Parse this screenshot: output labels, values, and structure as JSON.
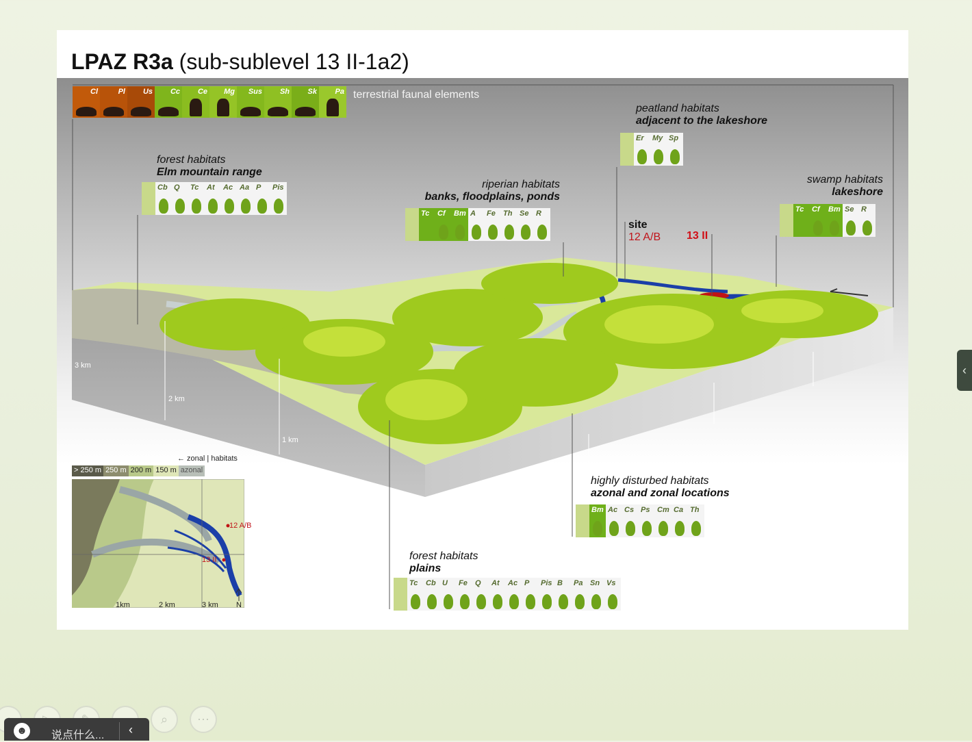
{
  "slide": {
    "title_bold": "LPAZ R3a",
    "title_rest": " (sub-sublevel 13 II-1a2)"
  },
  "fauna": {
    "caption": "terrestrial faunal elements",
    "cells": [
      {
        "code": "Cl",
        "color": "#c25a0a"
      },
      {
        "code": "Pl",
        "color": "#b85309"
      },
      {
        "code": "Us",
        "color": "#a84a08"
      },
      {
        "code": "Cc",
        "color": "#7fb51c"
      },
      {
        "code": "Ce",
        "color": "#8bbd20"
      },
      {
        "code": "Mg",
        "color": "#95c426"
      },
      {
        "code": "Sus",
        "color": "#84b81d"
      },
      {
        "code": "Sh",
        "color": "#8fc023"
      },
      {
        "code": "Sk",
        "color": "#7aae19"
      },
      {
        "code": "Pa",
        "color": "#9ac82c"
      }
    ]
  },
  "habitats": {
    "forest_elm": {
      "line1": "forest habitats",
      "line2": "Elm mountain range",
      "species": [
        "Cb",
        "Q",
        "Tc",
        "At",
        "Ac",
        "Aa",
        "P",
        "Pis"
      ]
    },
    "riperian": {
      "line1": "riperian habitats",
      "line2": "banks, floodplains, ponds",
      "species": [
        "Cf",
        "Bm",
        "A",
        "Fe",
        "Th",
        "Se",
        "R"
      ],
      "extra": "Tc"
    },
    "peatland": {
      "line1": "peatland habitats",
      "line2": "adjacent to the lakeshore",
      "species": [
        "Er",
        "My",
        "Sp"
      ]
    },
    "swamp": {
      "line1": "swamp habitats",
      "line2": "lakeshore",
      "species": [
        "Cf",
        "Bm",
        "Se",
        "R"
      ],
      "extra": "Tc"
    },
    "disturbed": {
      "line1": "highly disturbed habitats",
      "line2": "azonal and zonal locations",
      "species": [
        "Bm",
        "Ac",
        "Cs",
        "Ps",
        "Cm",
        "Ca",
        "Th"
      ]
    },
    "forest_plains": {
      "line1": "forest habitats",
      "line2": "plains",
      "species": [
        "Tc",
        "Cb",
        "U",
        "Fe",
        "Q",
        "At",
        "Ac",
        "P",
        "Pis",
        "B",
        "Pa",
        "Sn",
        "Vs"
      ]
    }
  },
  "site": {
    "label": "site",
    "ab": "12 A/B",
    "thirteen": "13 II"
  },
  "block_km": [
    "3 km",
    "2 km",
    "1 km"
  ],
  "inset": {
    "zonal_label": "← zonal",
    "habitats_label": "habitats",
    "legend": [
      {
        "text": "> 250 m",
        "color": "#5a5a4a",
        "fg": "#ffffff"
      },
      {
        "text": "250 m",
        "color": "#8d8d6e",
        "fg": "#ffffff"
      },
      {
        "text": "200 m",
        "color": "#b9c98a",
        "fg": "#222222"
      },
      {
        "text": "150 m",
        "color": "#dfe6b8",
        "fg": "#222222"
      },
      {
        "text": "azonal",
        "color": "#b8bfb8",
        "fg": "#555555"
      }
    ],
    "site_ab": "12 A/B",
    "site_13": "13 II",
    "km": [
      "1km",
      "2 km",
      "3 km"
    ],
    "north": "N"
  },
  "toolbar": {
    "buttons": [
      {
        "name": "previous-button",
        "glyph": "‹"
      },
      {
        "name": "play-button",
        "glyph": "▷"
      },
      {
        "name": "pen-button",
        "glyph": "✎"
      },
      {
        "name": "slides-button",
        "glyph": "▭"
      },
      {
        "name": "zoom-button",
        "glyph": "⌕"
      },
      {
        "name": "more-button",
        "glyph": "⋯"
      }
    ]
  },
  "chat": {
    "placeholder": "说点什么...",
    "collapse": "‹"
  },
  "side_handle": "‹"
}
